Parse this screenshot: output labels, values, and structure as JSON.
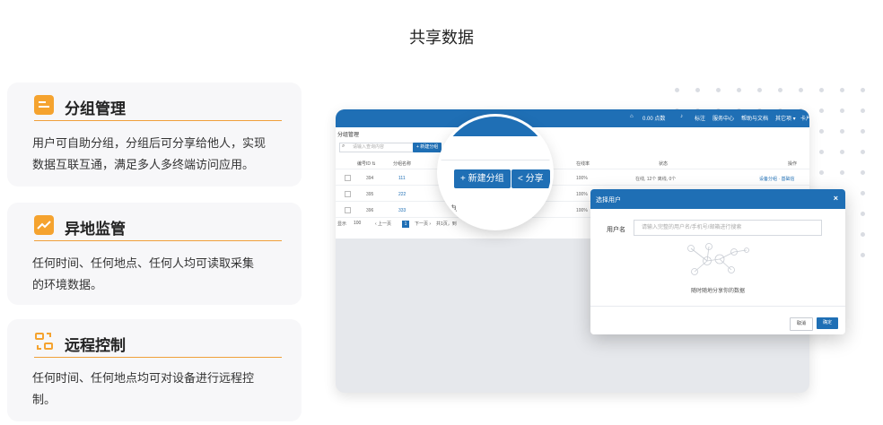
{
  "page": {
    "title": "共享数据"
  },
  "features": [
    {
      "title": "分组管理",
      "desc_line1": "用户可自助分组，分组后可分享给他人，实现",
      "desc_line2": "数据互联互通，满足多人多终端访问应用。",
      "icon": "folder-icon"
    },
    {
      "title": "异地监管",
      "desc_line1": "任何时间、任何地点、任何人均可读取采集",
      "desc_line2": "的环境数据。",
      "icon": "trend-chart-icon"
    },
    {
      "title": "远程控制",
      "desc_line1": "任何时间、任何地点均可对设备进行远程控",
      "desc_line2": "制。",
      "icon": "remote-control-icon"
    }
  ],
  "colors": {
    "accent": "#f5a32f",
    "primary": "#1f6fb5",
    "card_bg": "#f7f7f9"
  },
  "mock": {
    "nav": [
      "0.00 点数",
      "标注",
      "服务中心",
      "帮助与文档",
      "其它项 ▾",
      "卡片"
    ],
    "crumb": "分组管理",
    "search_placeholder": "请输入查询内容",
    "add_btn": "+ 新建分组",
    "share_btn": "< 分享",
    "columns": [
      "编号ID ⇅",
      "分组名称",
      "在线率",
      "状态",
      "操作"
    ],
    "rows": [
      {
        "id": "394",
        "name": "111",
        "rate": "100%",
        "status": "在线, 12个  离线, 0个",
        "op": "设备分组 · 基础信"
      },
      {
        "id": "395",
        "name": "222",
        "rate": "100%"
      },
      {
        "id": "396",
        "name": "333",
        "rate": "100%"
      }
    ],
    "pager": {
      "size_prefix": "显示",
      "size": "100",
      "prev": "‹ 上一页",
      "current": "1",
      "next": "下一页 ›",
      "total": "共1页，到"
    }
  },
  "magnifier": {
    "add_btn": "+ 新建分组",
    "share_btn": "< 分享",
    "fragment_left": "电",
    "fragment_right": "点"
  },
  "dialog": {
    "title": "选择用户",
    "close": "×",
    "username_label": "用户名",
    "username_placeholder": "请输入完整的用户名/手机号/邮箱进行搜索",
    "hint": "随时随地分享你的数据",
    "cancel": "取消",
    "confirm": "确定"
  }
}
